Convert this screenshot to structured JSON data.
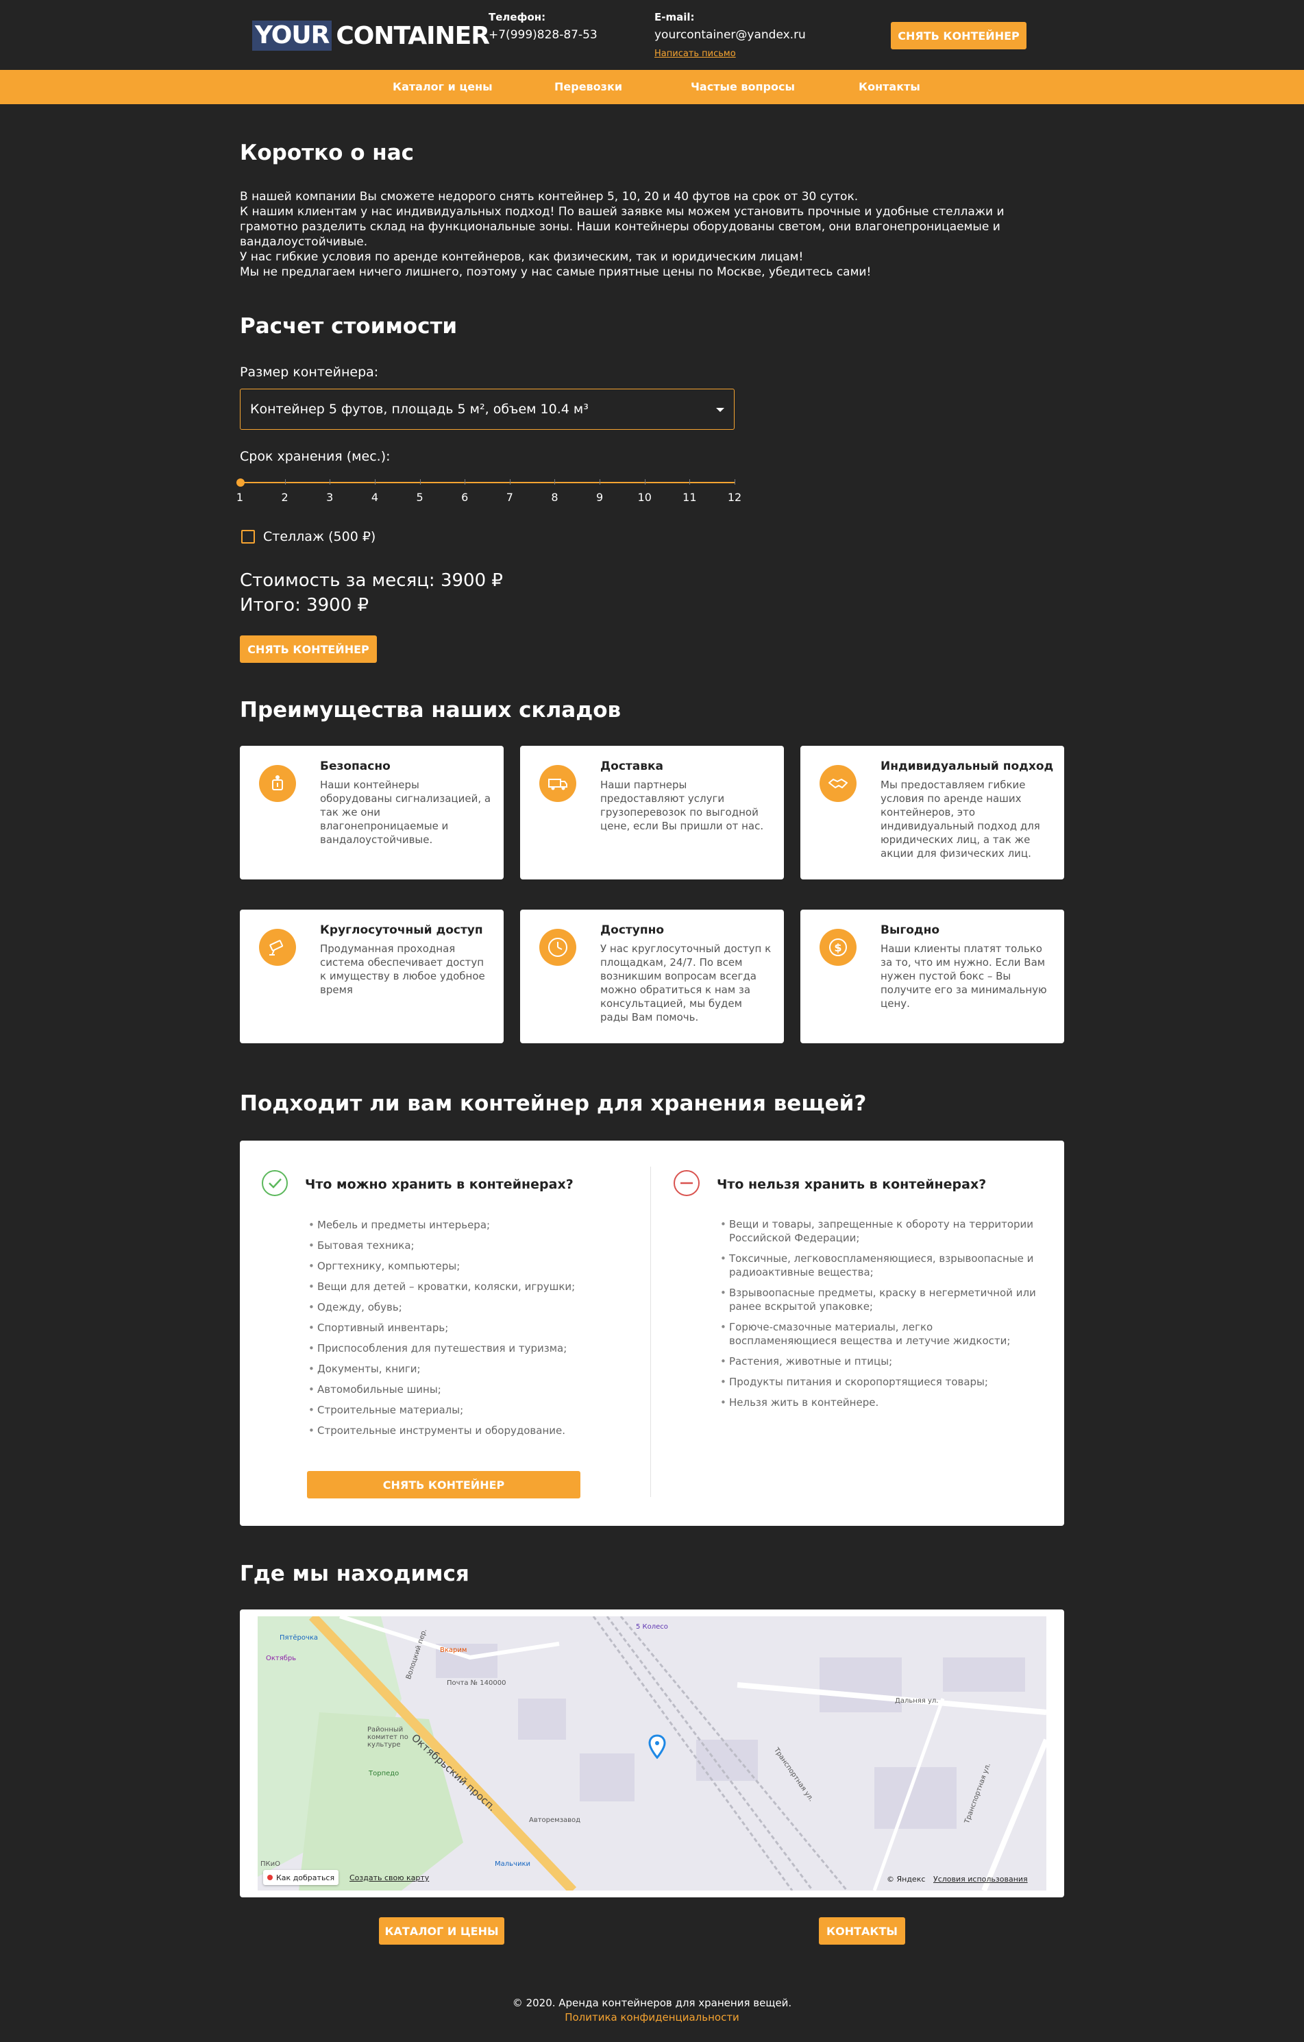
{
  "header": {
    "logo_part1": "YOUR",
    "logo_part2": "CONTAINER",
    "phone_label": "Телефон:",
    "phone_value": "+7(999)828-87-53",
    "email_label": "E-mail:",
    "email_value": "yourcontainer@yandex.ru",
    "write_link": "Написать письмо",
    "cta_button": "СНЯТЬ КОНТЕЙНЕР"
  },
  "nav": {
    "items": [
      "Каталог и цены",
      "Перевозки",
      "Частые вопросы",
      "Контакты"
    ]
  },
  "about": {
    "title": "Коротко о нас",
    "paragraphs": [
      "В нашей компании Вы сможете недорого снять контейнер 5, 10, 20 и 40 футов на срок от 30 суток.",
      "К нашим клиентам у нас индивидуальных подход! По вашей заявке мы можем установить прочные и удобные стеллажи и грамотно разделить склад на функциональные зоны. Наши контейнеры оборудованы светом, они влагонепроницаемые и вандалоустойчивые.",
      "У нас гибкие условия по аренде контейнеров, как физическим, так и юридическим лицам!",
      "Мы не предлагаем ничего лишнего, поэтому у нас самые приятные цены по Москве, убедитесь сами!"
    ]
  },
  "calc": {
    "title": "Расчет стоимости",
    "size_label": "Размер контейнера:",
    "size_selected": "Контейнер 5 футов, площадь 5 м², объем 10.4 м³",
    "term_label": "Срок хранения (мес.):",
    "ticks": [
      "1",
      "2",
      "3",
      "4",
      "5",
      "6",
      "7",
      "8",
      "9",
      "10",
      "11",
      "12"
    ],
    "term_value": 1,
    "shelf_label": "Стеллаж (500 ₽)",
    "monthly": "Стоимость за месяц: 3900 ₽",
    "total": "Итого: 3900 ₽",
    "button": "СНЯТЬ КОНТЕЙНЕР"
  },
  "advantages": {
    "title": "Преимущества наших складов",
    "cards": [
      {
        "icon": "alarm-icon",
        "title": "Безопасно",
        "text": "Наши контейнеры оборудованы сигнализацией, а так же они влагонепроницаемые и вандалоустойчивые."
      },
      {
        "icon": "truck-icon",
        "title": "Доставка",
        "text": "Наши партнеры предоставляют услуги грузоперевозок по выгодной цене, если Вы пришли от нас."
      },
      {
        "icon": "handshake-icon",
        "title": "Индивидуальный подход",
        "text": "Мы предоставляем гибкие условия по аренде наших контейнеров, это индивидуальный подход для юридических лиц, а так же акции для физических лиц."
      },
      {
        "icon": "camera-icon",
        "title": "Круглосуточный доступ",
        "text": "Продуманная проходная система обеспечивает доступ к имуществу в любое удобное время"
      },
      {
        "icon": "clock-icon",
        "title": "Доступно",
        "text": "У нас круглосуточный доступ к площадкам, 24/7. По всем возникшим вопросам всегда можно обратиться к нам за консультацией, мы будем рады Вам помочь."
      },
      {
        "icon": "coin-icon",
        "title": "Выгодно",
        "text": "Наши клиенты платят только за то, что им нужно. Если Вам нужен пустой бокс – Вы получите его за минимальную цену."
      }
    ]
  },
  "suits": {
    "title": "Подходит ли вам контейнер для хранения вещей?",
    "allowed_title": "Что можно хранить в контейнерах?",
    "allowed": [
      "Мебель и предметы интерьера;",
      "Бытовая техника;",
      "Оргтехнику, компьютеры;",
      "Вещи для детей – кроватки, коляски, игрушки;",
      "Одежду, обувь;",
      "Спортивный инвентарь;",
      "Приспособления для путешествия и туризма;",
      "Документы, книги;",
      "Автомобильные шины;",
      "Строительные материалы;",
      "Строительные инструменты и оборудование."
    ],
    "forbidden_title": "Что нельзя хранить в контейнерах?",
    "forbidden": [
      "Вещи и товары, запрещенные к обороту на территории Российской Федерации;",
      "Токсичные, легковоспламеняющиеся, взрывоопасные и радиоактивные вещества;",
      "Взрывоопасные предметы, краску в негерметичной или ранее вскрытой упаковке;",
      "Горюче-смазочные материалы, легко воспламеняющиеся вещества и летучие жидкости;",
      "Растения, животные и птицы;",
      "Продукты питания и скоропортящиеся товары;",
      "Нельзя жить в контейнере."
    ],
    "button": "СНЯТЬ КОНТЕЙНЕР"
  },
  "location": {
    "title": "Где мы находимся",
    "map_labels": {
      "street1": "Октябрьский просп.",
      "street2": "Волоцкий пер.",
      "street3": "Дальняя ул.",
      "street4": "Транспортная ул.",
      "street5": "Транспортная ул.",
      "poi1": "Пятёрочка",
      "poi2": "Октябрь",
      "poi3": "Вкарим",
      "poi4": "Почта № 140000",
      "poi5": "Районный комитет по культуре",
      "poi6": "Торпедо",
      "poi7": "Авторемзавод",
      "poi8": "Мальчики",
      "poi9": "5 Колесо",
      "poi10": "ПКиО",
      "route": "Как добраться",
      "own_map": "Создать свою карту",
      "copyright": "© Яндекс",
      "terms": "Условия использования"
    }
  },
  "bottom_buttons": {
    "catalog": "КАТАЛОГ И ЦЕНЫ",
    "contacts": "КОНТАКТЫ"
  },
  "footer": {
    "copyright": "© 2020. Аренда контейнеров для хранения вещей.",
    "privacy": "Политика конфиденциальности"
  },
  "colors": {
    "accent": "#f6a431",
    "background": "#242424",
    "ok": "#5cb85c",
    "no": "#d9534f"
  }
}
